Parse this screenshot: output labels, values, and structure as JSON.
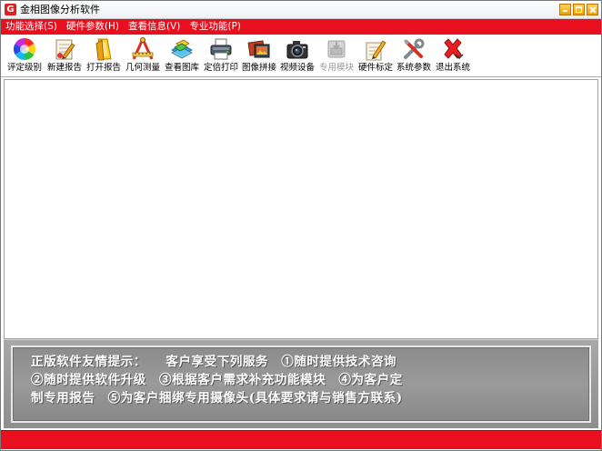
{
  "window": {
    "title": "金相图像分析软件",
    "icon_letter": "G"
  },
  "menu": [
    {
      "label": "功能选择(S)"
    },
    {
      "label": "硬件参数(H)"
    },
    {
      "label": "查看信息(V)"
    },
    {
      "label": "专业功能(P)"
    }
  ],
  "toolbar": [
    {
      "label": "评定级别",
      "icon": "color-wheel-icon",
      "enabled": true
    },
    {
      "label": "新建报告",
      "icon": "new-report-icon",
      "enabled": true
    },
    {
      "label": "打开报告",
      "icon": "open-report-icon",
      "enabled": true
    },
    {
      "label": "几何测量",
      "icon": "geometry-measure-icon",
      "enabled": true
    },
    {
      "label": "查看图库",
      "icon": "gallery-icon",
      "enabled": true
    },
    {
      "label": "定倍打印",
      "icon": "printer-icon",
      "enabled": true
    },
    {
      "label": "图像拼接",
      "icon": "image-stitch-icon",
      "enabled": true
    },
    {
      "label": "视频设备",
      "icon": "camera-icon",
      "enabled": true
    },
    {
      "label": "专用模块",
      "icon": "module-icon",
      "enabled": false
    },
    {
      "label": "硬件标定",
      "icon": "calibrate-icon",
      "enabled": true
    },
    {
      "label": "系统参数",
      "icon": "tools-icon",
      "enabled": true
    },
    {
      "label": "退出系统",
      "icon": "exit-icon",
      "enabled": true
    }
  ],
  "notice": {
    "lines": [
      "正版软件友情提示：　　客户享受下列服务　①随时提供技术咨询",
      "②随时提供软件升级　③根据客户需求补充功能模块　④为客户定",
      "制专用报告　⑤为客户捆绑专用摄像头(具体要求请与销售方联系)"
    ]
  },
  "colors": {
    "accent_red": "#e8101e",
    "panel_gray": "#999999"
  }
}
